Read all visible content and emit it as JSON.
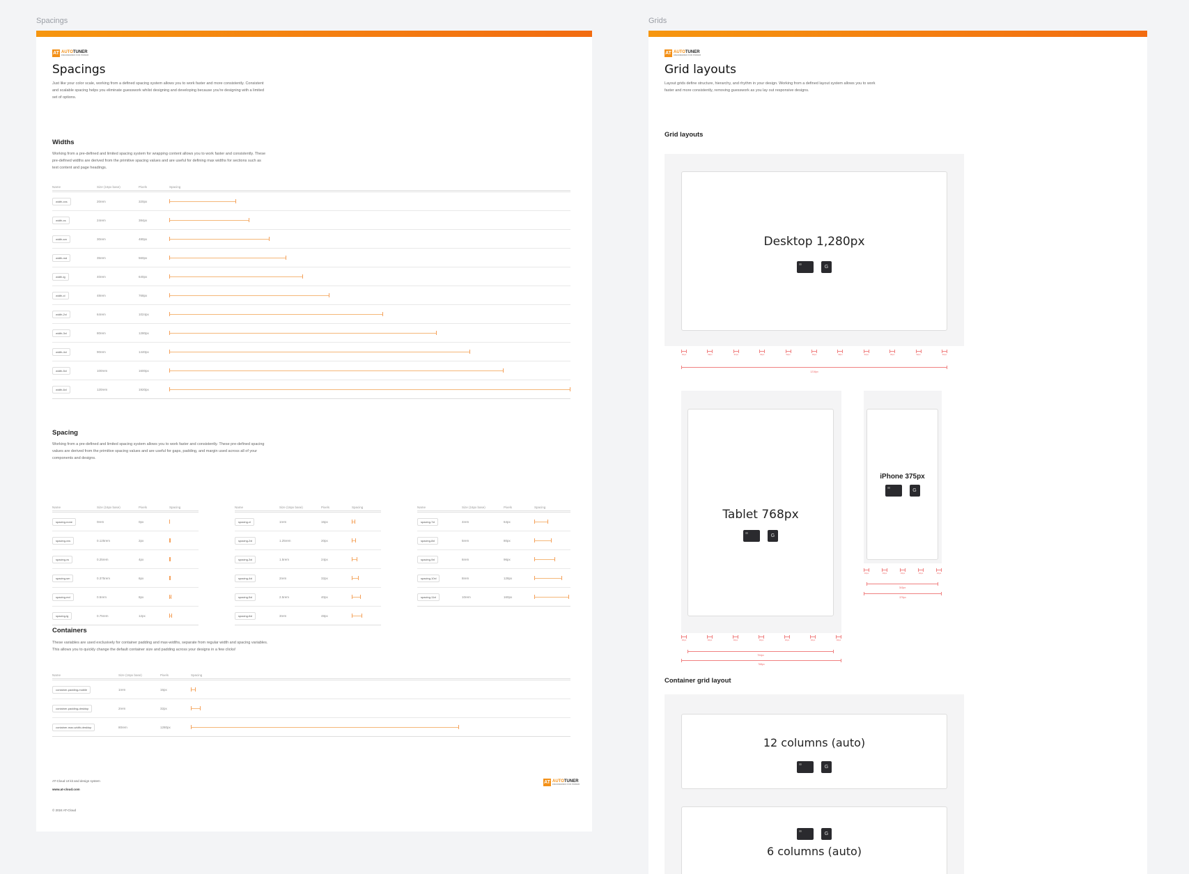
{
  "colors": {
    "accent": "#f39017",
    "bar": "#f5a05a",
    "measure": "#f08080"
  },
  "spacings": {
    "frame_label": "Spacings",
    "logo": {
      "mark": "AT",
      "name_a": "AUTO",
      "name_b": "TUNER",
      "sub": "ENGINEERED FOR POWER"
    },
    "title": "Spacings",
    "intro": "Just like your color scale, working from a defined spacing system allows you to work faster and more consistently. Consistent and scalable spacing helps you eliminate guesswork whilst designing and developing because you're designing with a limited set of options.",
    "widths": {
      "heading": "Widths",
      "desc": "Working from a pre-defined and limited spacing system for wrapping content allows you to work faster and consistently. These pre-defined widths are derived from the primitive spacing values and are useful for defining max widths for sections such as text content and page headings.",
      "cols": [
        "Name",
        "Size (16px base)",
        "Pixels",
        "Spacing"
      ],
      "rows": [
        {
          "name": "width-xxs",
          "size": "20rem",
          "px": "320px",
          "frac": 0.167
        },
        {
          "name": "width-xs",
          "size": "24rem",
          "px": "384px",
          "frac": 0.2
        },
        {
          "name": "width-sm",
          "size": "30rem",
          "px": "480px",
          "frac": 0.25
        },
        {
          "name": "width-md",
          "size": "35rem",
          "px": "560px",
          "frac": 0.292
        },
        {
          "name": "width-lg",
          "size": "40rem",
          "px": "640px",
          "frac": 0.333
        },
        {
          "name": "width-xl",
          "size": "48rem",
          "px": "768px",
          "frac": 0.4
        },
        {
          "name": "width-2xl",
          "size": "64rem",
          "px": "1024px",
          "frac": 0.533
        },
        {
          "name": "width-3xl",
          "size": "80rem",
          "px": "1280px",
          "frac": 0.667
        },
        {
          "name": "width-4xl",
          "size": "90rem",
          "px": "1440px",
          "frac": 0.75
        },
        {
          "name": "width-5xl",
          "size": "100rem",
          "px": "1600px",
          "frac": 0.833
        },
        {
          "name": "width-6xl",
          "size": "120rem",
          "px": "1920px",
          "frac": 1
        }
      ]
    },
    "spacing": {
      "heading": "Spacing",
      "desc": "Working from a pre-defined and limited spacing system allows you to work faster and consistently. These pre-defined spacing values are derived from the primitive spacing values and are useful for gaps, padding, and margin used across all of your components and designs.",
      "cols": [
        "Name",
        "Size (16px base)",
        "Pixels",
        "Spacing"
      ],
      "groups": [
        [
          {
            "name": "spacing-none",
            "size": "0rem",
            "px": "0px",
            "frac": 0
          },
          {
            "name": "spacing-xxs",
            "size": "0.125rem",
            "px": "2px",
            "frac": 0.012
          },
          {
            "name": "spacing-xs",
            "size": "0.25rem",
            "px": "4px",
            "frac": 0.025
          },
          {
            "name": "spacing-sm",
            "size": "0.375rem",
            "px": "6px",
            "frac": 0.037
          },
          {
            "name": "spacing-md",
            "size": "0.5rem",
            "px": "8px",
            "frac": 0.05
          },
          {
            "name": "spacing-lg",
            "size": "0.75rem",
            "px": "12px",
            "frac": 0.075
          }
        ],
        [
          {
            "name": "spacing-xl",
            "size": "1rem",
            "px": "16px",
            "frac": 0.1
          },
          {
            "name": "spacing-2xl",
            "size": "1.25rem",
            "px": "20px",
            "frac": 0.125
          },
          {
            "name": "spacing-3xl",
            "size": "1.5rem",
            "px": "24px",
            "frac": 0.15
          },
          {
            "name": "spacing-4xl",
            "size": "2rem",
            "px": "32px",
            "frac": 0.2
          },
          {
            "name": "spacing-5xl",
            "size": "2.5rem",
            "px": "40px",
            "frac": 0.25
          },
          {
            "name": "spacing-6xl",
            "size": "3rem",
            "px": "48px",
            "frac": 0.3
          }
        ],
        [
          {
            "name": "spacing-7xl",
            "size": "4rem",
            "px": "64px",
            "frac": 0.4
          },
          {
            "name": "spacing-8xl",
            "size": "5rem",
            "px": "80px",
            "frac": 0.5
          },
          {
            "name": "spacing-9xl",
            "size": "6rem",
            "px": "96px",
            "frac": 0.6
          },
          {
            "name": "spacing-10xl",
            "size": "8rem",
            "px": "128px",
            "frac": 0.8
          },
          {
            "name": "spacing-11xl",
            "size": "10rem",
            "px": "160px",
            "frac": 1
          }
        ]
      ]
    },
    "containers": {
      "heading": "Containers",
      "desc": "These variables are used exclusively for container padding and max-widths, separate from regular width and spacing variables. This allows you to quickly change the default container size and padding across your designs in a few clicks!",
      "cols": [
        "Name",
        "Size (16px base)",
        "Pixels",
        "Spacing"
      ],
      "rows": [
        {
          "name": "container-padding-mobile",
          "size": "1rem",
          "px": "16px",
          "frac": 0.0125
        },
        {
          "name": "container-padding-desktop",
          "size": "2rem",
          "px": "32px",
          "frac": 0.025
        },
        {
          "name": "container-max-width-desktop",
          "size": "80rem",
          "px": "1280px",
          "frac": 0.706
        }
      ]
    },
    "footer": {
      "line1": "AT-Cloud UI kit and design system",
      "line2": "www.at-cloud.com",
      "copyright": "© 2024 AT-Cloud"
    }
  },
  "grids": {
    "frame_label": "Grids",
    "logo": {
      "mark": "AT",
      "name_a": "AUTO",
      "name_b": "TUNER",
      "sub": "ENGINEERED FOR POWER"
    },
    "title": "Grid layouts",
    "intro": "Layout grids define structure, hierarchy, and rhythm in your design. Working from a defined layout system allows you to work faster and more consistently, removing guesswork as you lay out responsive designs.",
    "section1": "Grid layouts",
    "desktop": {
      "title": "Desktop 1,280px",
      "gutters": [
        "32px",
        "32px",
        "32px",
        "32px",
        "32px",
        "32px",
        "32px",
        "32px",
        "32px",
        "32px",
        "32px"
      ],
      "total": "1216px"
    },
    "tablet": {
      "title": "Tablet 768px",
      "gutters": [
        "32px",
        "32px",
        "32px",
        "32px",
        "32px",
        "32px",
        "32px"
      ],
      "inner": "704px",
      "total": "768px"
    },
    "iphone": {
      "title": "iPhone 375px",
      "gutters": [
        "16px",
        "16px",
        "16px",
        "16px",
        "16px"
      ],
      "inner": "343px",
      "total": "375px"
    },
    "section2": "Container grid layout",
    "container12": {
      "title": "12 columns (auto)"
    },
    "container6": {
      "title": "6 columns (auto)"
    },
    "icon_g": "G"
  }
}
